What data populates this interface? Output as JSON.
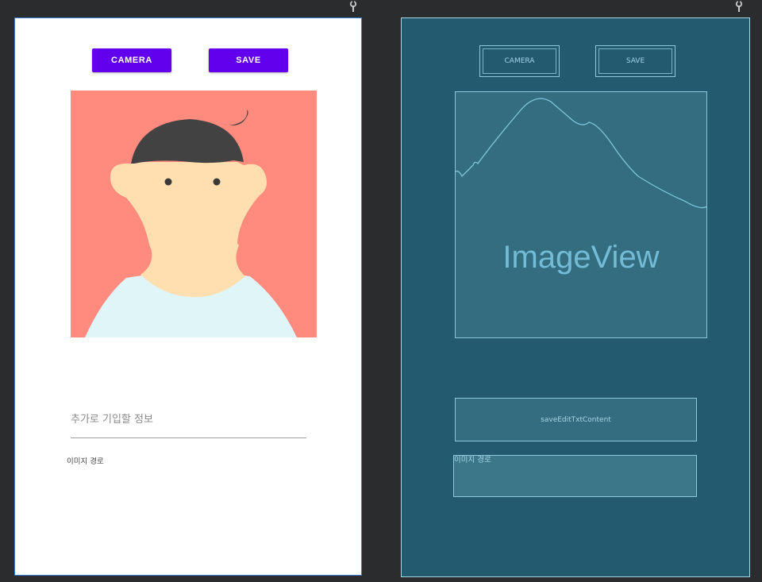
{
  "design": {
    "camera_label": "CAMERA",
    "save_label": "SAVE",
    "edit_hint": "추가로 기입할 정보",
    "image_path_label": "이미지 경로"
  },
  "blueprint": {
    "camera_label": "CAMERA",
    "save_label": "SAVE",
    "image_view_label": "ImageView",
    "edit_text_id": "saveEditTxtContent",
    "text_view_label": "이미지 경로"
  },
  "colors": {
    "button": "#6200ee",
    "avatar_bg": "#ff8a7e",
    "skin": "#ffdfb0",
    "hair": "#424242",
    "shirt": "#e0f5f8",
    "blueprint_bg": "#235a70",
    "blueprint_line": "#8dc7db"
  },
  "icons": {
    "pin": "pin-icon"
  }
}
